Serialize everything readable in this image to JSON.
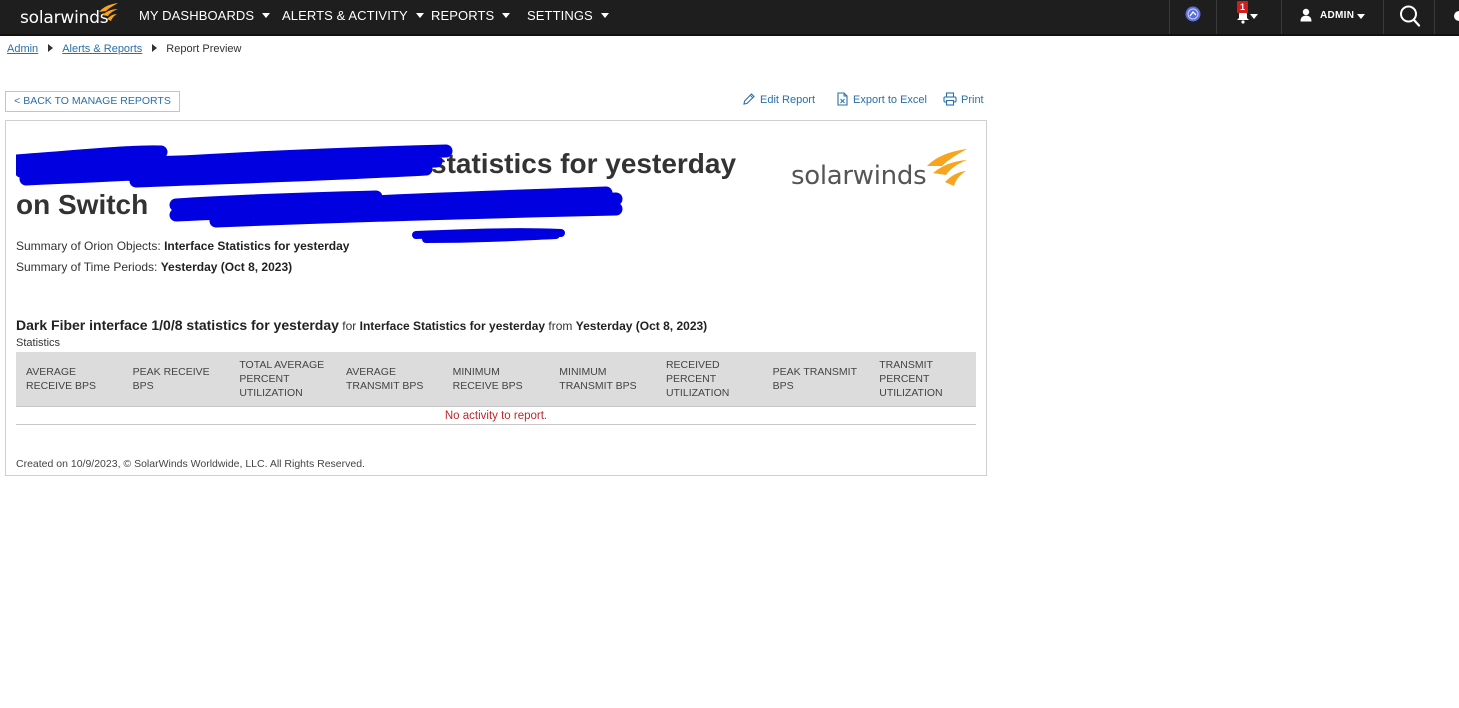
{
  "topbar": {
    "brand": "solarwinds",
    "nav": [
      {
        "label": "MY DASHBOARDS"
      },
      {
        "label": "ALERTS & ACTIVITY"
      },
      {
        "label": "REPORTS"
      },
      {
        "label": "SETTINGS"
      }
    ],
    "notification_count": "1",
    "user": "ADMIN",
    "icons": [
      "orion-maps-icon",
      "bell-icon",
      "user-icon",
      "search-icon"
    ]
  },
  "breadcrumb": {
    "items": [
      "Admin",
      "Alerts & Reports"
    ],
    "current": "Report Preview"
  },
  "actions": {
    "back": "< BACK TO MANAGE REPORTS",
    "edit": "Edit Report",
    "export": "Export to Excel",
    "print": "Print"
  },
  "report": {
    "title_line1_visible": "statistics for yesterday",
    "title_line2_visible": "on Switch",
    "logo_text": "solarwinds",
    "summary_objects_label": "Summary of Orion Objects:",
    "summary_objects_value": "Interface Statistics for yesterday",
    "summary_time_label": "Summary of Time Periods:",
    "summary_time_value": "Yesterday (Oct 8, 2023)",
    "section": {
      "title": "Dark Fiber interface 1/0/8 statistics for yesterday",
      "for_word": "for",
      "for_value": "Interface Statistics for yesterday",
      "from_word": "from",
      "from_value": "Yesterday (Oct 8, 2023)"
    },
    "stats_label": "Statistics",
    "columns": [
      "AVERAGE RECEIVE BPS",
      "PEAK RECEIVE BPS",
      "TOTAL AVERAGE PERCENT UTILIZATION",
      "AVERAGE TRANSMIT BPS",
      "MINIMUM RECEIVE BPS",
      "MINIMUM TRANSMIT BPS",
      "RECEIVED PERCENT UTILIZATION",
      "PEAK TRANSMIT BPS",
      "TRANSMIT PERCENT UTILIZATION"
    ],
    "empty_message": "No activity to report.",
    "footer": "Created on 10/9/2023,   © SolarWinds Worldwide, LLC. All Rights Reserved."
  },
  "colors": {
    "topbar_bg": "#1e1e1e",
    "link": "#2a6fa8",
    "brand_orange": "#f7a51d",
    "redaction": "#0000e0",
    "empty_text": "#c0262d",
    "header_bg": "#dcdcdc"
  }
}
